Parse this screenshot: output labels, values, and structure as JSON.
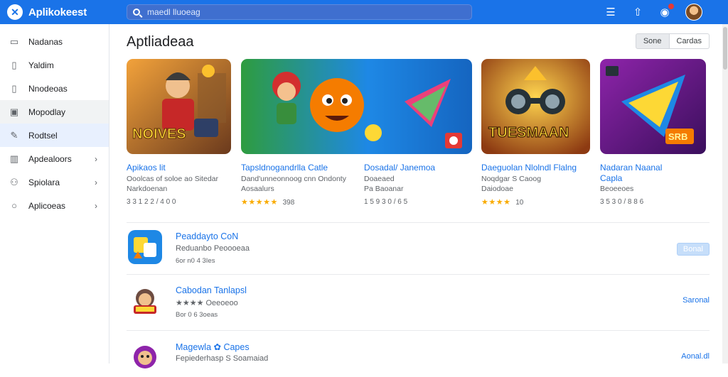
{
  "app": {
    "title": "Aplikokeest",
    "logo_glyph": "✕",
    "brand_color": "#1a73e8"
  },
  "search": {
    "placeholder": "maedl lluoeag",
    "value": ""
  },
  "topbar_icons": [
    "grid-icon",
    "share-icon",
    "notifications-icon",
    "avatar"
  ],
  "sidebar": {
    "items": [
      {
        "label": "Nadanas",
        "icon": "bookmark-icon",
        "state": "",
        "chevron": false
      },
      {
        "label": "Yaldim",
        "icon": "file-icon",
        "state": "",
        "chevron": false
      },
      {
        "label": "Nnodeoas",
        "icon": "file-icon",
        "state": "",
        "chevron": false
      },
      {
        "label": "Mopodlay",
        "icon": "monitor-icon",
        "state": "hover",
        "chevron": false
      },
      {
        "label": "Rodtsel",
        "icon": "pen-icon",
        "state": "active",
        "chevron": false
      },
      {
        "label": "Apdealoors",
        "icon": "column-icon",
        "state": "",
        "chevron": true
      },
      {
        "label": "Spiolara",
        "icon": "user-icon",
        "state": "",
        "chevron": true
      },
      {
        "label": "Aplicoeas",
        "icon": "circle-icon",
        "state": "",
        "chevron": true
      }
    ]
  },
  "main": {
    "title": "Aptliadeaa",
    "sort_options": [
      "Sone",
      "Cardas"
    ],
    "featured": [
      {
        "name": "Apikaos lit",
        "desc1": "Ooolcas of soloe ao Sitedar",
        "desc2": "Narkdoenan",
        "meta": "3 3 1 2 2 / 4 0 0",
        "stars": "",
        "rating": ""
      },
      {
        "name": "Tapsldnogandrlla Catle",
        "desc1": "Dand'unneonnoog cnn Ondonty",
        "desc2": "Aosaalurs",
        "meta": "",
        "stars": "★★★★★",
        "rating": "398"
      },
      {
        "name": "Dosadal/ Janemoa",
        "desc1": "Doaeaed",
        "desc2": "Pa Baoanar",
        "meta": "1 5 9 3 0 / 6 5",
        "stars": "",
        "rating": ""
      },
      {
        "name": "Daeguolan Nlolndl Flalng",
        "desc1": "Noqdgar S Caoog",
        "desc2": "Daiodoae",
        "meta": "",
        "stars": "★★★★",
        "rating": "10"
      },
      {
        "name": "Nadaran Naanal",
        "desc1": "",
        "desc2": "Beoeeoes",
        "meta": "3 5 3 0 / 8 8 6",
        "stars": "",
        "rating": "",
        "name2": "Capla"
      }
    ],
    "list": [
      {
        "name": "Peaddayto CoN",
        "sub": "Reduanbo Peoooeaa",
        "meta": "6or n0 4 3Ies",
        "action": "Bonal",
        "action_style": "button"
      },
      {
        "name": "Cabodan Tanlapsl",
        "sub": "★★★★ Oeeoeoo",
        "meta": "Bor 0 6 3oeas",
        "action": "Saronal",
        "action_style": "link"
      },
      {
        "name": "Magewla ✿ Capes",
        "sub": "Fepiederhasp S Soamaiad",
        "meta": "",
        "action": "Aonal.dl",
        "action_style": "link"
      }
    ]
  }
}
